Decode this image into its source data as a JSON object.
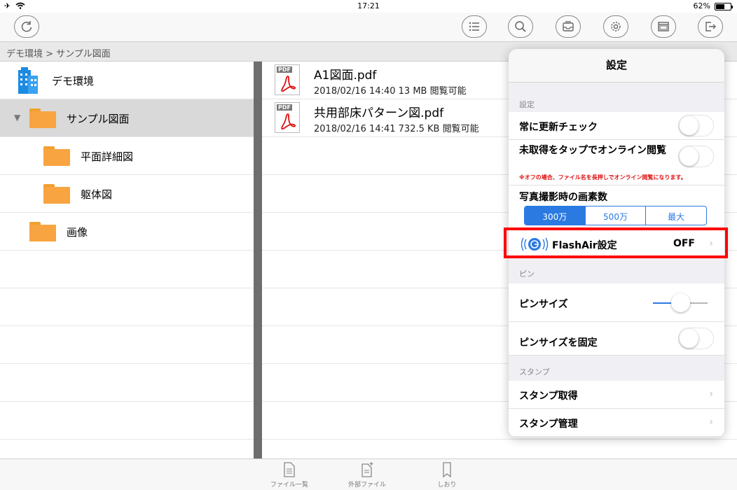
{
  "status": {
    "time": "17:21",
    "battery": "62%",
    "battery_level": 0.62
  },
  "toolbar": {
    "refresh": "refresh-icon",
    "list": "list-icon",
    "search": "search-icon",
    "inbox": "inbox-icon",
    "settings": "gear-icon",
    "window": "window-icon",
    "logout": "logout-icon"
  },
  "breadcrumb": "デモ環境 > サンプル図面",
  "tree": {
    "root": "デモ環境",
    "folders": [
      "サンプル図面",
      "平面詳細図",
      "躯体図",
      "画像"
    ]
  },
  "files": [
    {
      "name": "A1図面.pdf",
      "meta": "2018/02/16 14:40  13 MB  閲覧可能",
      "tag": "PDF"
    },
    {
      "name": "共用部床パターン図.pdf",
      "meta": "2018/02/16 14:41  732.5 KB  閲覧可能",
      "tag": "PDF"
    }
  ],
  "settings": {
    "title": "設定",
    "section_general": "設定",
    "always_check_update": "常に更新チェック",
    "tap_online": "未取得をタップでオンライン閲覧",
    "tap_online_note": "※オフの場合、ファイル名を長押しでオンライン閲覧になります。",
    "photo_pixels": "写真撮影時の画素数",
    "pixel_options": [
      "300万",
      "500万",
      "最大"
    ],
    "flashair_label": "FlashAir設定",
    "flashair_value": "OFF",
    "section_pin": "ピン",
    "pin_size": "ピンサイズ",
    "pin_size_level": 0.5,
    "pin_size_fixed": "ピンサイズを固定",
    "section_stamp": "スタンプ",
    "stamp_get": "スタンプ取得",
    "stamp_manage": "スタンプ管理",
    "accent": "#2a7ae2"
  },
  "tabbar": {
    "file_list": "ファイル一覧",
    "external": "外部ファイル",
    "bookmark": "しおり"
  }
}
